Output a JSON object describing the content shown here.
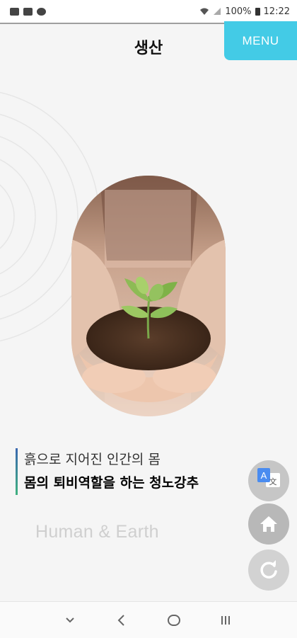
{
  "status_bar": {
    "battery": "100%",
    "time": "12:22"
  },
  "header": {
    "title": "생산",
    "menu_label": "MENU"
  },
  "content": {
    "line1": "흙으로 지어진 인간의 몸",
    "line2": "몸의 퇴비역할을 하는 청노강추",
    "subtitle": "Human & Earth"
  },
  "fabs": {
    "translate_letter": "A",
    "translate_char": "文"
  },
  "colors": {
    "menu": "#43cbe6",
    "accent_top": "#3a66b0",
    "accent_bottom": "#3fb27f",
    "fab": "#b8b8b8"
  },
  "icons": [
    "image-icon",
    "cloud-icon",
    "sync-icon",
    "wifi-icon",
    "signal-icon",
    "battery-icon",
    "translate-icon",
    "home-icon",
    "refresh-icon",
    "nav-down-icon",
    "nav-back-icon",
    "nav-home-icon",
    "nav-recents-icon"
  ]
}
